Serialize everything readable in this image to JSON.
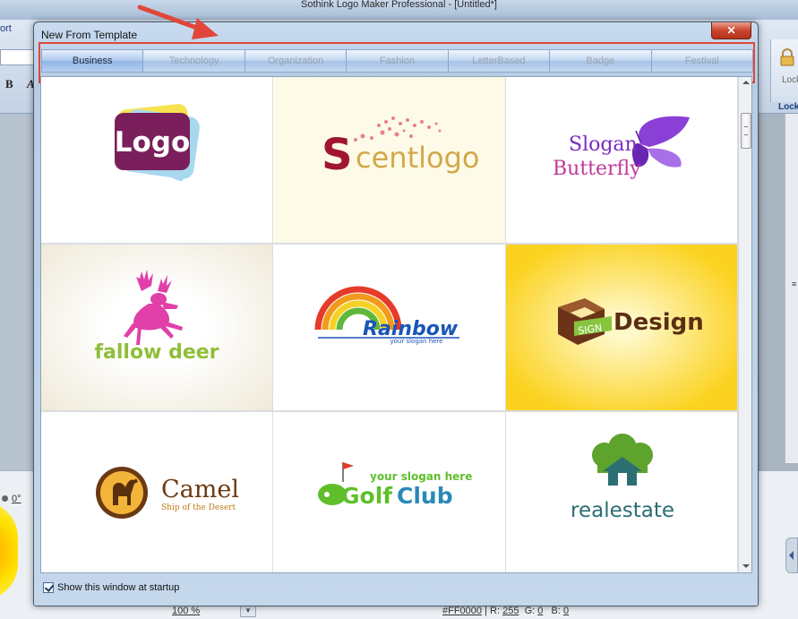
{
  "app": {
    "title": "Sothink Logo Maker Professional - [Untitled*]",
    "ribbon_tab_fragment": "ort",
    "bold_label": "B",
    "italic_label": "A",
    "lock_button_label": "Lock",
    "lock_group_label": "Lock",
    "angle_value": "0°",
    "zoom_value": "100 %",
    "color_hex": "#FF0000",
    "color_r_label": "R:",
    "color_r": "255",
    "color_g_label": "G:",
    "color_g": "0",
    "color_b_label": "B:",
    "color_b": "0",
    "right_marker": "≡"
  },
  "dialog": {
    "title": "New From Template",
    "close_label": "✕",
    "tabs": [
      {
        "label": "Business",
        "active": true
      },
      {
        "label": "Technology",
        "active": false
      },
      {
        "label": "Organization",
        "active": false
      },
      {
        "label": "Fashion",
        "active": false
      },
      {
        "label": "LetterBased",
        "active": false
      },
      {
        "label": "Badge",
        "active": false
      },
      {
        "label": "Festival",
        "active": false
      }
    ],
    "templates": [
      {
        "text": "Logo",
        "bg": "#ffffff"
      },
      {
        "text": "Scentlogo",
        "part1": "S",
        "part2": "centlogo",
        "bg": "#fdfbe8"
      },
      {
        "text": "Slogan Butterfly",
        "line1": "Slogan",
        "line2": "Butterfly",
        "bg": "#ffffff"
      },
      {
        "text": "fallow deer",
        "bg": "#f6f2e6"
      },
      {
        "text": "Rainbow",
        "slogan": "your slogan here",
        "bg": "#ffffff"
      },
      {
        "text": "Design",
        "badge": "SIGN",
        "bg": "#fbd21f"
      },
      {
        "text": "Camel",
        "slogan": "Ship of the Desert",
        "bg": "#ffffff"
      },
      {
        "text": "GolfClub",
        "part1": "Golf",
        "part2": "Club",
        "slogan": "your slogan here",
        "bg": "#ffffff"
      },
      {
        "text": "realestate",
        "bg": "#ffffff"
      }
    ],
    "show_at_startup_label": "Show this window at startup",
    "show_at_startup_checked": true
  },
  "colors": {
    "highlight": "#e0473a",
    "logo_purple": "#7a1f5c",
    "scent_red": "#a0162f",
    "scent_gold": "#d2a84a",
    "butterfly_purple": "#8a3fd6",
    "deer_pink": "#e040a8",
    "rainbow_blue": "#1a55b8",
    "design_brown": "#5b2d12",
    "camel_brown": "#6b3a12",
    "golf_green": "#5fbf2b",
    "estate_green": "#5ea32c",
    "estate_teal": "#2b6e73"
  }
}
